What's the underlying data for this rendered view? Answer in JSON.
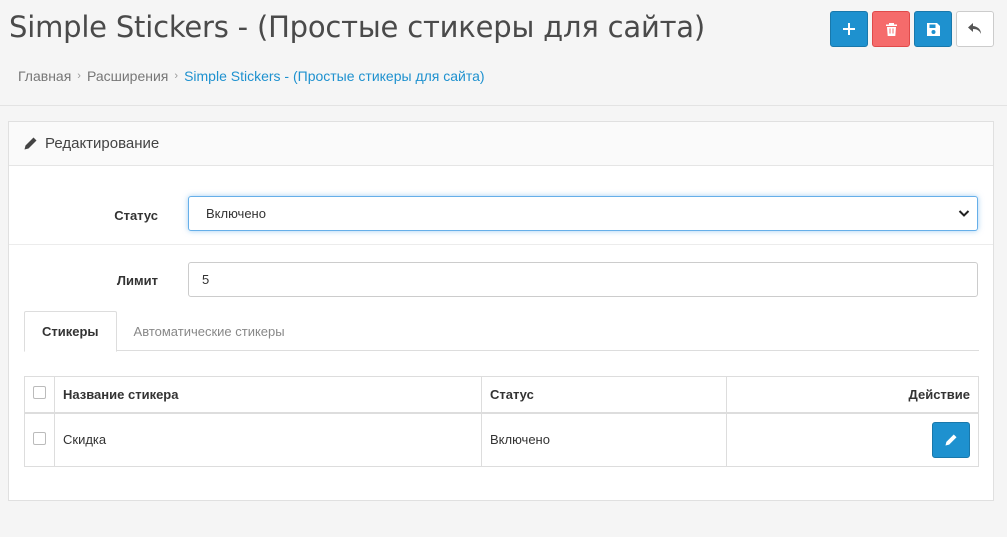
{
  "header": {
    "title": "Simple Stickers - (Простые стикеры для сайта)",
    "buttons": [
      {
        "icon": "plus-icon",
        "color": "#1e91cf"
      },
      {
        "icon": "trash-icon",
        "color": "#f56b6b"
      },
      {
        "icon": "save-icon",
        "color": "#1e91cf"
      },
      {
        "icon": "back-arrow-icon",
        "color": "#ffffff"
      }
    ]
  },
  "breadcrumb": {
    "items": [
      "Главная",
      "Расширения",
      "Simple Stickers - (Простые стикеры для сайта)"
    ]
  },
  "panel": {
    "heading": "Редактирование",
    "status_label": "Статус",
    "status_value": "Включено",
    "limit_label": "Лимит",
    "limit_value": "5"
  },
  "tabs": [
    "Стикеры",
    "Автоматические стикеры"
  ],
  "table": {
    "columns": [
      "Название стикера",
      "Статус",
      "Действие"
    ],
    "rows": [
      {
        "name": "Скидка",
        "status": "Включено"
      }
    ]
  }
}
